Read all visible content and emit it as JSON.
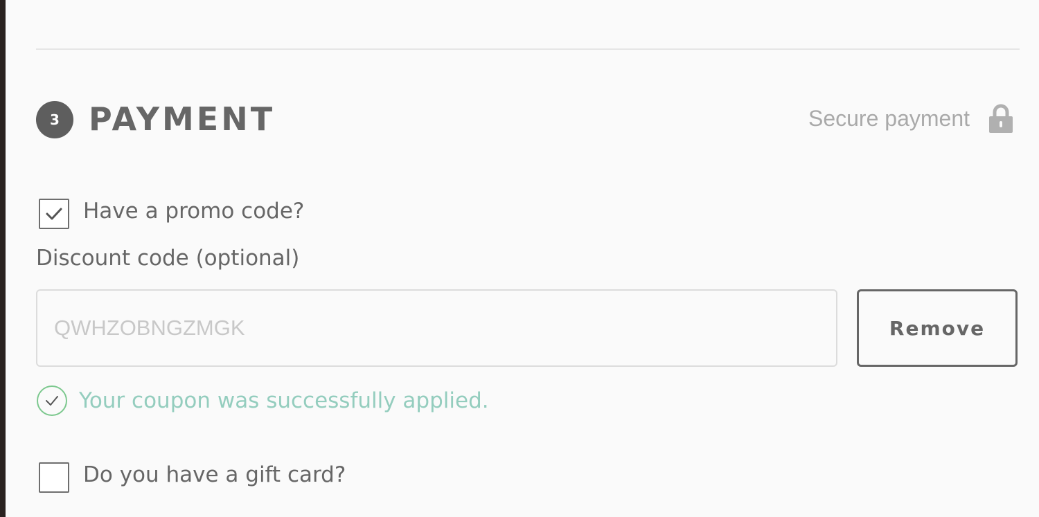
{
  "payment": {
    "step_number": "3",
    "title": "PAYMENT",
    "secure_label": "Secure payment",
    "secure_icon": "lock-icon"
  },
  "promo": {
    "checkbox_label": "Have a promo code?",
    "checked": true,
    "field_label": "Discount code (optional)",
    "code_value": "QWHZOBNGZMGK",
    "remove_label": "Remove",
    "success_message": "Your coupon was successfully applied.",
    "success_icon": "check-circle-icon"
  },
  "gift_card": {
    "checkbox_label": "Do you have a gift card?",
    "checked": false
  },
  "colors": {
    "text": "#666666",
    "muted": "#a9a9a9",
    "success": "#94cdbe",
    "success_icon": "#7cc88e",
    "background": "#fafafa"
  }
}
